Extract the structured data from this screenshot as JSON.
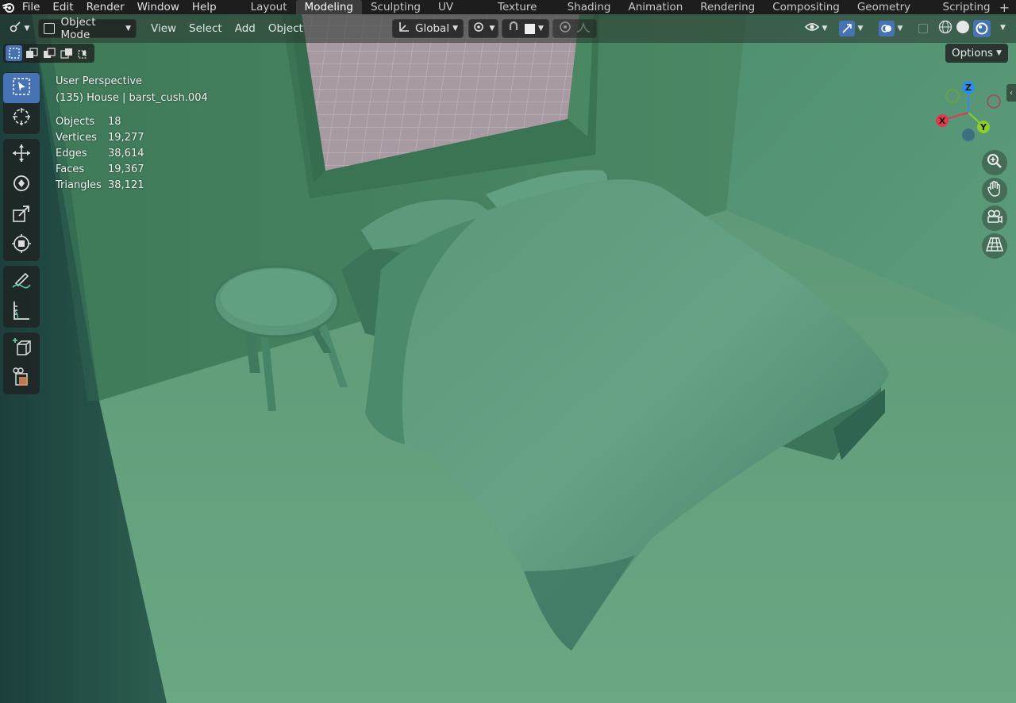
{
  "menu": {
    "items": [
      "File",
      "Edit",
      "Render",
      "Window",
      "Help"
    ]
  },
  "workspaces": {
    "tabs": [
      "Layout",
      "Modeling",
      "Sculpting",
      "UV Editing",
      "Texture Paint",
      "Shading",
      "Animation",
      "Rendering",
      "Compositing",
      "Geometry Nodes",
      "Scripting"
    ],
    "active": "Modeling"
  },
  "header": {
    "mode": "Object Mode",
    "menus": [
      "View",
      "Select",
      "Add",
      "Object"
    ],
    "orientation": "Global",
    "options_label": "Options"
  },
  "viewport": {
    "view_name": "User Perspective",
    "context": "(135) House | barst_cush.004",
    "stats": [
      {
        "label": "Objects",
        "value": "18"
      },
      {
        "label": "Vertices",
        "value": "19,277"
      },
      {
        "label": "Edges",
        "value": "38,614"
      },
      {
        "label": "Faces",
        "value": "19,367"
      },
      {
        "label": "Triangles",
        "value": "38,121"
      }
    ]
  },
  "gizmo": {
    "x_label": "X",
    "y_label": "Y",
    "z_label": "Z",
    "x_color": "#e0384f",
    "y_color": "#8bcf2a",
    "z_color": "#2f8de8"
  },
  "colors": {
    "accent": "#4772b3",
    "scene_green": "#5a9373"
  }
}
